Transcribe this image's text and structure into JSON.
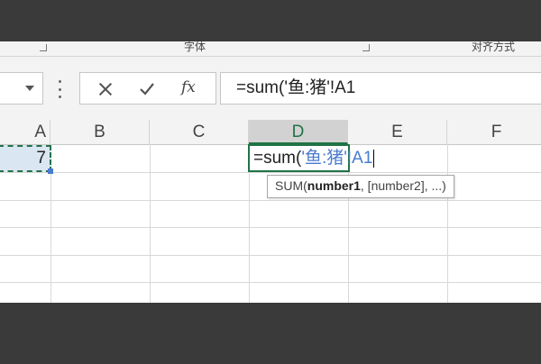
{
  "ribbon": {
    "groups": [
      {
        "label": "字体"
      },
      {
        "label": "对齐方式"
      }
    ]
  },
  "formula_bar": {
    "cancel_icon": "cancel-icon",
    "enter_icon": "enter-icon",
    "fx_label": "fx",
    "formula_text": "=sum('鱼:猪'!A1"
  },
  "grid": {
    "columns": [
      "A",
      "B",
      "C",
      "D",
      "E",
      "F"
    ],
    "active_column": "D",
    "cells": {
      "A1": "7",
      "D1": {
        "prefix": "=sum(",
        "reference": "'鱼:猪'!A1"
      }
    },
    "tooltip": {
      "func": "SUM(",
      "arg1": "number1",
      "rest": ", [number2], ...)"
    }
  },
  "colors": {
    "accent_green": "#217346",
    "reference_blue": "#4a7bd0",
    "selection_fill": "#dbe6f3",
    "frame_dark": "#3a3a3a"
  }
}
